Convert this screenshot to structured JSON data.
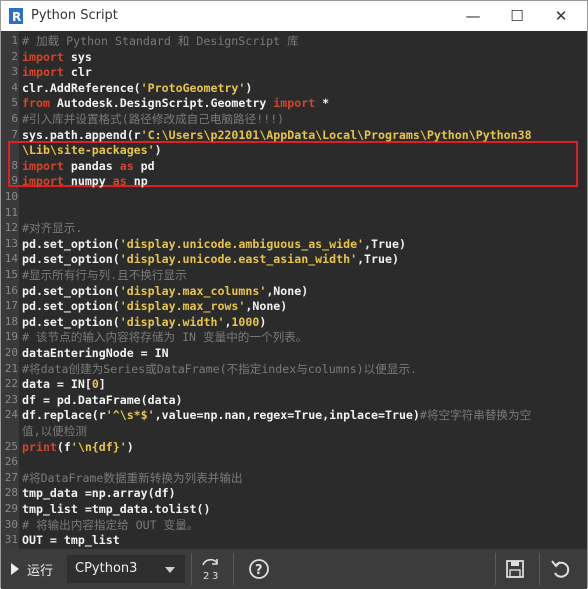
{
  "window": {
    "title": "Python Script",
    "controls": {
      "minimize": "—",
      "maximize": "☐",
      "close": "✕"
    }
  },
  "editor": {
    "lines": [
      {
        "n": "1",
        "tokens": [
          {
            "t": "cm",
            "v": "# 加载 Python Standard 和 DesignScript 库"
          }
        ]
      },
      {
        "n": "2",
        "tokens": [
          {
            "t": "kw",
            "v": "import"
          },
          {
            "t": "plain",
            "v": " sys"
          }
        ]
      },
      {
        "n": "3",
        "tokens": [
          {
            "t": "kw",
            "v": "import"
          },
          {
            "t": "plain",
            "v": " clr"
          }
        ]
      },
      {
        "n": "4",
        "tokens": [
          {
            "t": "plain",
            "v": "clr.AddReference("
          },
          {
            "t": "str",
            "v": "'ProtoGeometry'"
          },
          {
            "t": "plain",
            "v": ")"
          }
        ]
      },
      {
        "n": "5",
        "tokens": [
          {
            "t": "kw",
            "v": "from"
          },
          {
            "t": "plain",
            "v": " Autodesk.DesignScript.Geometry "
          },
          {
            "t": "kw",
            "v": "import"
          },
          {
            "t": "plain",
            "v": " *"
          }
        ]
      },
      {
        "n": "6",
        "tokens": [
          {
            "t": "cm",
            "v": "#引入库并设置格式(路径修改成自己电脑路径!!!)"
          }
        ]
      },
      {
        "n": "7",
        "tokens": [
          {
            "t": "plain",
            "v": "sys.path.append(r"
          },
          {
            "t": "str",
            "v": "'C:\\Users\\p220101\\AppData\\Local\\Programs\\Python\\Python38"
          }
        ]
      },
      {
        "n": "",
        "tokens": [
          {
            "t": "str",
            "v": "\\Lib\\site-packages'"
          },
          {
            "t": "plain",
            "v": ")"
          }
        ]
      },
      {
        "n": "8",
        "tokens": [
          {
            "t": "kw",
            "v": "import"
          },
          {
            "t": "plain",
            "v": " pandas "
          },
          {
            "t": "kw",
            "v": "as"
          },
          {
            "t": "plain",
            "v": " pd"
          }
        ]
      },
      {
        "n": "9",
        "tokens": [
          {
            "t": "kw",
            "v": "import"
          },
          {
            "t": "plain",
            "v": " numpy "
          },
          {
            "t": "kw",
            "v": "as"
          },
          {
            "t": "plain",
            "v": " np"
          }
        ]
      },
      {
        "n": "10",
        "tokens": []
      },
      {
        "n": "11",
        "tokens": []
      },
      {
        "n": "12",
        "tokens": [
          {
            "t": "cm",
            "v": "#对齐显示."
          }
        ]
      },
      {
        "n": "13",
        "tokens": [
          {
            "t": "plain",
            "v": "pd.set_option("
          },
          {
            "t": "str",
            "v": "'display.unicode.ambiguous_as_wide'"
          },
          {
            "t": "plain",
            "v": ",True)"
          }
        ]
      },
      {
        "n": "14",
        "tokens": [
          {
            "t": "plain",
            "v": "pd.set_option("
          },
          {
            "t": "str",
            "v": "'display.unicode.east_asian_width'"
          },
          {
            "t": "plain",
            "v": ",True)"
          }
        ]
      },
      {
        "n": "15",
        "tokens": [
          {
            "t": "cm",
            "v": "#显示所有行与列.且不换行显示"
          }
        ]
      },
      {
        "n": "16",
        "tokens": [
          {
            "t": "plain",
            "v": "pd.set_option("
          },
          {
            "t": "str",
            "v": "'display.max_columns'"
          },
          {
            "t": "plain",
            "v": ",None)"
          }
        ]
      },
      {
        "n": "17",
        "tokens": [
          {
            "t": "plain",
            "v": "pd.set_option("
          },
          {
            "t": "str",
            "v": "'display.max_rows'"
          },
          {
            "t": "plain",
            "v": ",None)"
          }
        ]
      },
      {
        "n": "18",
        "tokens": [
          {
            "t": "plain",
            "v": "pd.set_option("
          },
          {
            "t": "str",
            "v": "'display.width'"
          },
          {
            "t": "plain",
            "v": ","
          },
          {
            "t": "num",
            "v": "1000"
          },
          {
            "t": "plain",
            "v": ")"
          }
        ]
      },
      {
        "n": "19",
        "tokens": [
          {
            "t": "cm",
            "v": "# 该节点的输入内容将存储为 IN 变量中的一个列表。"
          }
        ]
      },
      {
        "n": "20",
        "tokens": [
          {
            "t": "plain",
            "v": "dataEnteringNode = IN"
          }
        ]
      },
      {
        "n": "21",
        "tokens": [
          {
            "t": "cm",
            "v": "#将data创建为Series或DataFrame(不指定index与columns)以便显示."
          }
        ]
      },
      {
        "n": "22",
        "tokens": [
          {
            "t": "plain",
            "v": "data = IN["
          },
          {
            "t": "num",
            "v": "0"
          },
          {
            "t": "plain",
            "v": "]"
          }
        ]
      },
      {
        "n": "23",
        "tokens": [
          {
            "t": "plain",
            "v": "df = pd.DataFrame(data)"
          }
        ]
      },
      {
        "n": "24",
        "tokens": [
          {
            "t": "plain",
            "v": "df.replace(r"
          },
          {
            "t": "str",
            "v": "'^\\s*$'"
          },
          {
            "t": "plain",
            "v": ",value=np.nan,regex=True,inplace=True)"
          },
          {
            "t": "cm",
            "v": "#将空字符串替换为空"
          }
        ]
      },
      {
        "n": "",
        "tokens": [
          {
            "t": "cm",
            "v": "值,以便检测"
          }
        ]
      },
      {
        "n": "25",
        "tokens": [
          {
            "t": "kw",
            "v": "print"
          },
          {
            "t": "plain",
            "v": "(f"
          },
          {
            "t": "str",
            "v": "'\\n{df}'"
          },
          {
            "t": "plain",
            "v": ")"
          }
        ]
      },
      {
        "n": "26",
        "tokens": []
      },
      {
        "n": "27",
        "tokens": [
          {
            "t": "cm",
            "v": "#将DataFrame数据重新转换为列表并输出"
          }
        ]
      },
      {
        "n": "28",
        "tokens": [
          {
            "t": "plain",
            "v": "tmp_data =np.array(df)"
          }
        ]
      },
      {
        "n": "29",
        "tokens": [
          {
            "t": "plain",
            "v": "tmp_list =tmp_data.tolist()"
          }
        ]
      },
      {
        "n": "30",
        "tokens": [
          {
            "t": "cm",
            "v": "# 将输出内容指定给 OUT 变量。"
          }
        ]
      },
      {
        "n": "31",
        "tokens": [
          {
            "t": "plain",
            "v": "OUT = tmp_list"
          }
        ]
      }
    ]
  },
  "toolbar": {
    "run_label": "运行",
    "engine_value": "CPython3",
    "migrate_glyph": "2→3",
    "help_glyph": "?",
    "save_glyph": "save",
    "revert_glyph": "undo"
  },
  "colors": {
    "editor_bg": "#2b2b2b",
    "keyword": "#d2452b",
    "string": "#e8c44a",
    "comment": "#7a7a7a",
    "highlight_border": "#e02020"
  }
}
